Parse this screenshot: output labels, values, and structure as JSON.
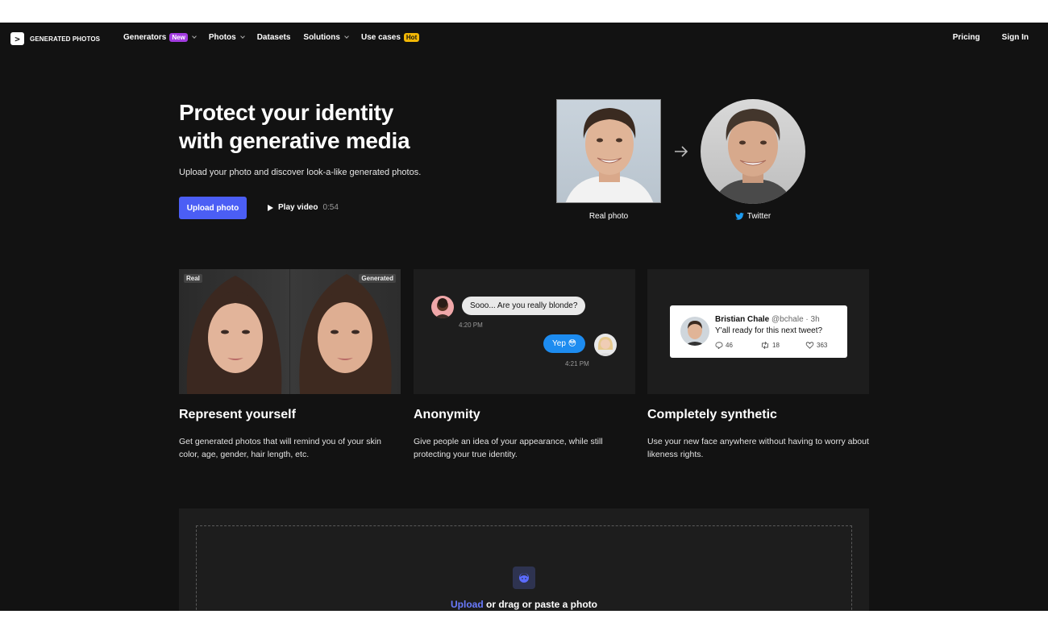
{
  "nav": {
    "logo_glyph": ">",
    "logo_text": "GENERATED PHOTOS",
    "links": [
      {
        "label": "Generators",
        "badge": "New"
      },
      {
        "label": "Photos"
      },
      {
        "label": "Datasets"
      },
      {
        "label": "Solutions"
      },
      {
        "label": "Use cases",
        "badge": "Hot"
      }
    ],
    "pricing": "Pricing",
    "sign_in": "Sign In"
  },
  "hero": {
    "title_line1": "Protect your identity",
    "title_line2": "with generative media",
    "subtitle": "Upload your photo and discover look-a-like generated photos.",
    "upload_button": "Upload photo",
    "play_label": "Play video",
    "play_duration": "0:54",
    "real_caption": "Real photo",
    "twitter_caption": "Twitter"
  },
  "cards": {
    "tag_real": "Real",
    "tag_generated": "Generated",
    "chat": {
      "incoming": "Sooo... Are you really blonde?",
      "incoming_time": "4:20 PM",
      "outgoing": "Yep 😳",
      "outgoing_time": "4:21 PM"
    },
    "tweet": {
      "name": "Bristian Chale",
      "handle": "@bchale · 3h",
      "text": "Y'all ready for this next tweet?",
      "replies": "46",
      "retweets": "18",
      "likes": "363"
    }
  },
  "features": [
    {
      "title": "Represent yourself",
      "desc": "Get generated photos that will remind you of your skin color, age, gender, hair length, etc."
    },
    {
      "title": "Anonymity",
      "desc": "Give people an idea of your appearance, while still protecting your true identity."
    },
    {
      "title": "Completely synthetic",
      "desc": "Use your new face anywhere without having to worry about likeness rights."
    }
  ],
  "upload": {
    "link": "Upload",
    "rest": " or drag or paste a photo"
  },
  "colors": {
    "background": "#121212",
    "accent": "#4b5ef5",
    "badge_new": "#a23be0",
    "badge_hot": "#f2b705",
    "twitter_blue": "#1d9bf0"
  }
}
